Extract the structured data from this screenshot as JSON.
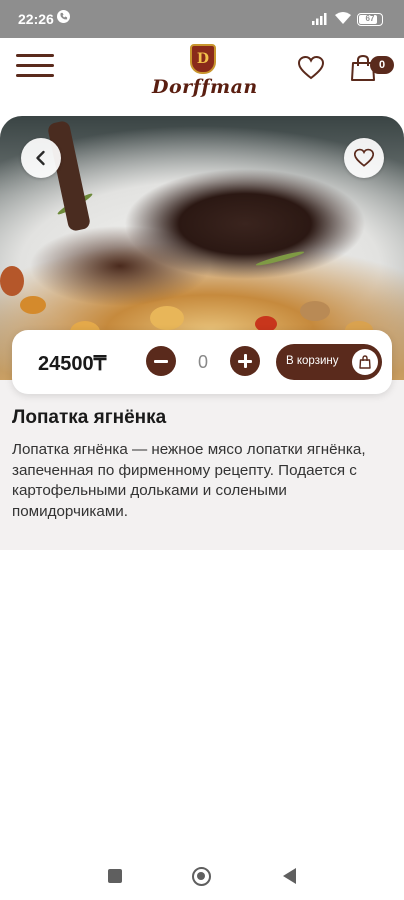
{
  "status_bar": {
    "time": "22:26",
    "battery": "67"
  },
  "header": {
    "brand": "Dorffman",
    "crest_letter": "D",
    "cart_count": "0"
  },
  "product": {
    "price": "24500₸",
    "quantity": "0",
    "add_to_cart_label": "В корзину",
    "title": "Лопатка ягнёнка",
    "description": "Лопатка ягнёнка — нежное мясо лопатки ягнёнка, запеченная по фирменному рецепту. Подается с картофельными дольками и солеными помидорчиками."
  },
  "colors": {
    "accent": "#5a2a1c",
    "panel": "#f3f1f1",
    "status_bar": "#8e8e8e"
  },
  "icons": [
    "menu-icon",
    "heart-icon",
    "shopping-bag-icon",
    "chevron-left-icon",
    "plus-icon",
    "minus-icon"
  ]
}
